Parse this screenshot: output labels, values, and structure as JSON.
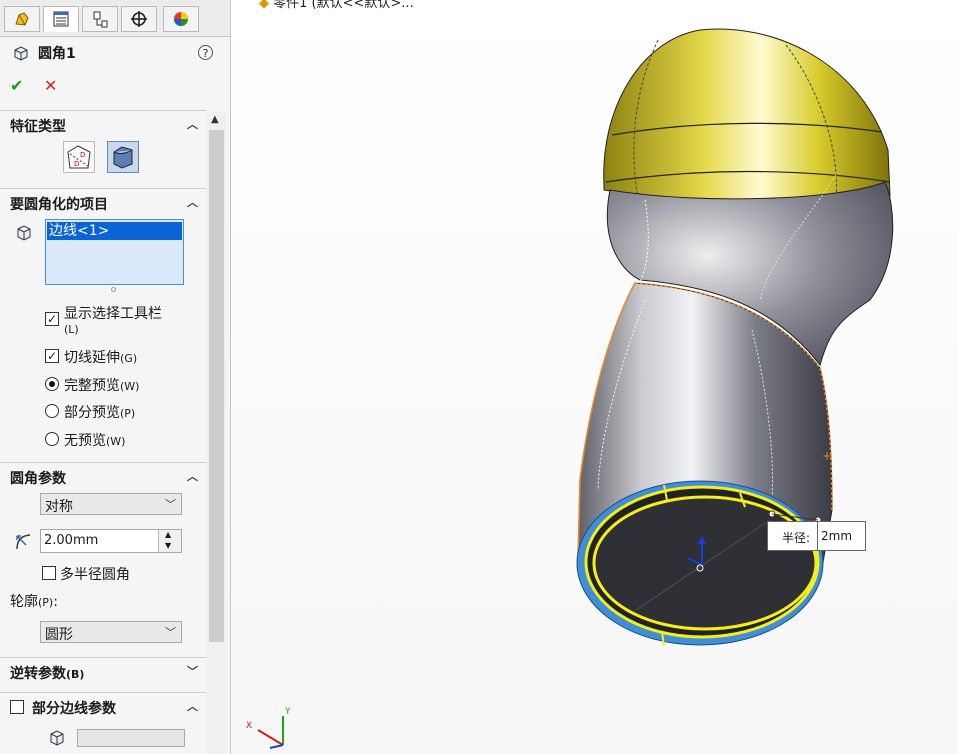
{
  "window": {
    "top_text": "零件1 (默认<<默认>..."
  },
  "tabs": [
    {
      "name": "feature-manager",
      "icon": "feature-tree-icon"
    },
    {
      "name": "property-manager",
      "icon": "property-list-icon",
      "active": true
    },
    {
      "name": "configuration-manager",
      "icon": "configuration-icon"
    },
    {
      "name": "dimxpert-manager",
      "icon": "crosshair-icon"
    },
    {
      "name": "display-manager",
      "icon": "appearance-pie-icon"
    }
  ],
  "header": {
    "title": "圆角1",
    "help": "?"
  },
  "sections": {
    "feature_type": {
      "label": "特征类型"
    },
    "items_to_fillet": {
      "label": "要圆角化的项目",
      "selection": "边线<1>",
      "show_toolbar": "显示选择工具栏",
      "show_toolbar_key": "(L)",
      "tangent": "切线延伸",
      "tangent_key": "(G)",
      "full_preview": "完整预览",
      "full_preview_key": "(W)",
      "partial_preview": "部分预览",
      "partial_preview_key": "(P)",
      "no_preview": "无预览",
      "no_preview_key": "(W)"
    },
    "fillet_params": {
      "label": "圆角参数",
      "method": "对称",
      "radius": "2.00mm",
      "multi_radius": "多半径圆角",
      "profile_label": "轮廓",
      "profile_key": "(P)",
      "profile_suffix": ":",
      "profile": "圆形"
    },
    "setback": {
      "label": "逆转参数",
      "label_key": "(B)"
    },
    "partial_edge": {
      "label": "部分边线参数"
    }
  },
  "viewport": {
    "radius_tip_label": "半径:",
    "radius_tip_value": "2mm",
    "triad_x": "X",
    "triad_y": "Y"
  },
  "colors": {
    "accent_select": "#0a64d6",
    "cap_yellow": "#d6c72c",
    "edge_orange": "#e9862a",
    "edge_yellow": "#f4ef1c",
    "ring_blue": "#3f8ed6"
  }
}
